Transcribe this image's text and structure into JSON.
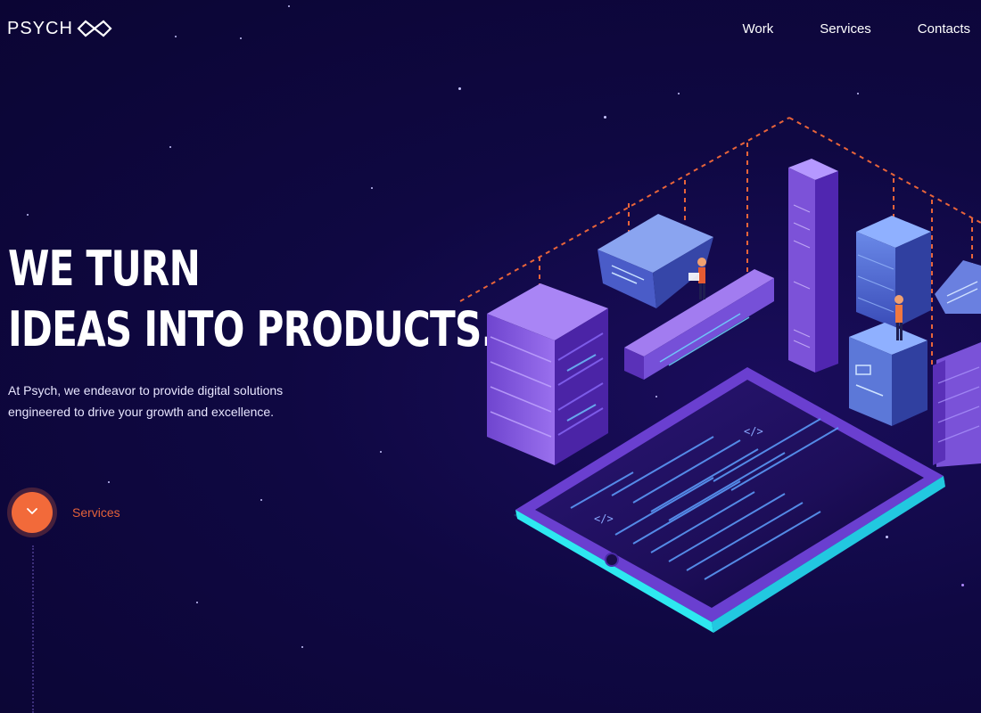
{
  "brand": {
    "logo_text": "PSYCH",
    "logo_icon": "infinity-diamond-icon"
  },
  "nav": {
    "items": [
      {
        "label": "Work"
      },
      {
        "label": "Services"
      },
      {
        "label": "Contacts"
      }
    ]
  },
  "hero": {
    "headline_line1": "WE TURN",
    "headline_line2": "IDEAS INTO PRODUCTS.",
    "description_line1": "At Psych, we endeavor to provide digital solutions",
    "description_line2": "engineered to drive your growth and excellence."
  },
  "cta": {
    "label": "Services",
    "icon": "chevron-down-icon"
  },
  "colors": {
    "background": "#0c0636",
    "accent": "#f26a3a",
    "tablet_glow": "#2ee8f0",
    "server_purple": "#7a4fd6"
  }
}
